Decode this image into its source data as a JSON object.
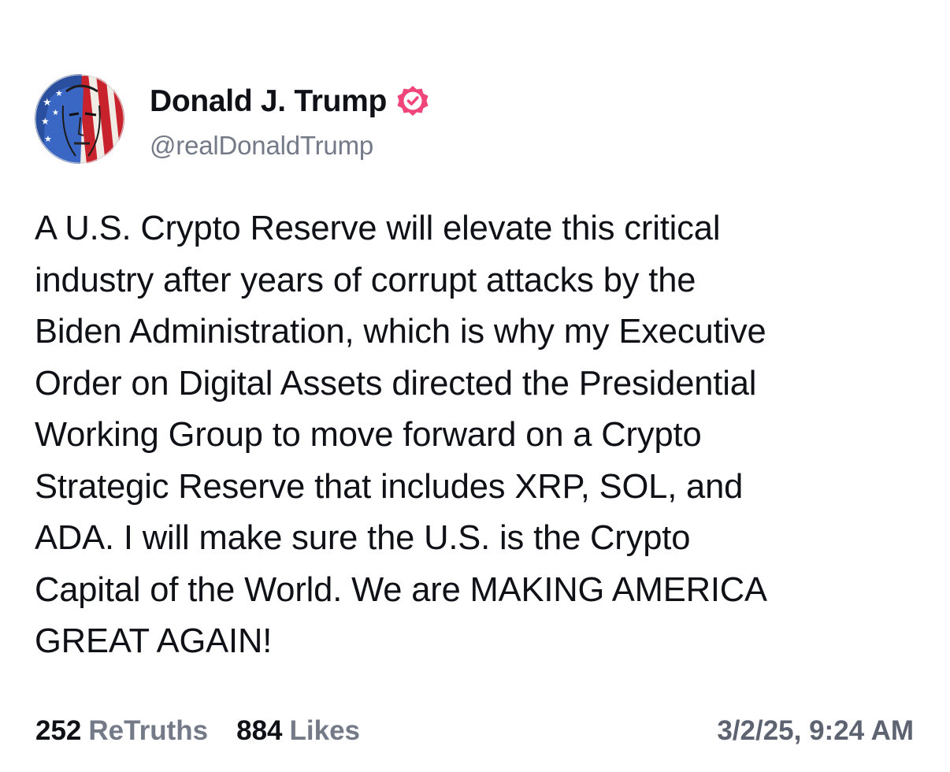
{
  "author": {
    "display_name": "Donald J. Trump",
    "handle": "@realDonaldTrump",
    "verified_icon": "verified-badge-icon",
    "avatar_icon": "profile-avatar-flag-portrait"
  },
  "post": {
    "text": "A U.S. Crypto Reserve will elevate this critical\nindustry after years of corrupt attacks by the\nBiden Administration, which is why my Executive\nOrder on Digital Assets directed the Presidential\nWorking Group to move forward on a Crypto\nStrategic Reserve that includes XRP, SOL, and\nADA. I will make sure the U.S. is the Crypto\nCapital of the World. We are MAKING AMERICA\nGREAT AGAIN!",
    "timestamp": "3/2/25, 9:24 AM"
  },
  "stats": {
    "retruths_count": "252",
    "retruths_label": "ReTruths",
    "likes_count": "884",
    "likes_label": "Likes"
  },
  "colors": {
    "text": "#0f1117",
    "muted": "#747a87",
    "badge": "#f0457a",
    "background": "#ffffff"
  }
}
